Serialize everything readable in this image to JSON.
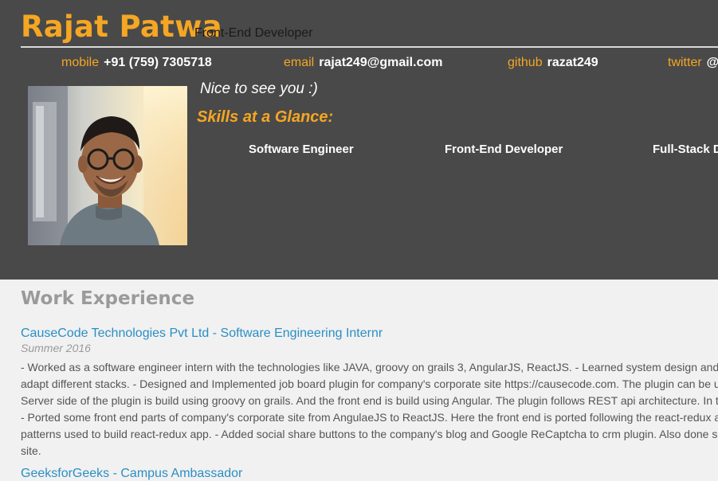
{
  "profile": {
    "name": "Rajat Patwa",
    "role": "Front-End Developer"
  },
  "contact": [
    {
      "label": "mobile",
      "value": "+91 (759) 7305718"
    },
    {
      "label": "email",
      "value": "rajat249@gmail.com"
    },
    {
      "label": "github",
      "value": "razat249"
    },
    {
      "label": "twitter",
      "value": "@"
    }
  ],
  "intro": {
    "greeting": "Nice to see you :)",
    "skills_title": "Skills at a Glance:",
    "skills": [
      "Software Engineer",
      "Front-End Developer",
      "Full-Stack D"
    ]
  },
  "work": {
    "heading": "Work Experience",
    "jobs": [
      {
        "title": "CauseCode Technologies Pvt Ltd - Software Engineering Internr",
        "date": "Summer 2016",
        "lines": [
          "- Worked as a software engineer intern with the technologies like JAVA, groovy on grails 3, AngularJS, ReactJS. - Learned system design and h",
          "adapt different stacks. - Designed and Implemented job board plugin for company's corporate site https://causecode.com. The plugin can be u",
          "Server side of the plugin is build using groovy on grails. And the front end is build using Angular. The plugin follows REST api architecture. In th",
          "- Ported some front end parts of company's corporate site from AngulaeJS to ReactJS. Here the front end is ported following the react-redux a",
          "patterns used to build react-redux app. - Added social share buttons to the company's blog and Google ReCaptcha to crm plugin. Also done so",
          "site."
        ]
      },
      {
        "title": "GeeksforGeeks - Campus Ambassador"
      }
    ]
  },
  "colors": {
    "accent": "#f5a623",
    "header_bg": "#494949",
    "link": "#2a8fc4"
  }
}
